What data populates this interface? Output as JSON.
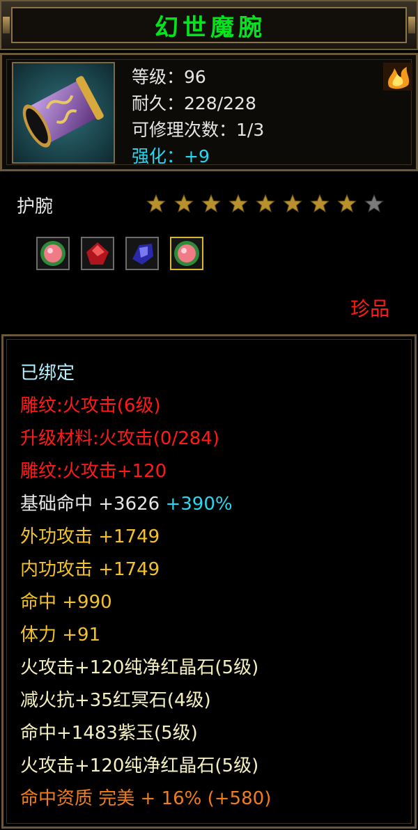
{
  "title": "幻世魔腕",
  "icon": {
    "name": "bracer-icon",
    "fire": "fire-emblem-icon"
  },
  "stats": {
    "level": "等级：96",
    "durability": "耐久：228/228",
    "repairs": "可修理次数：1/3",
    "enhance": "强化：+9"
  },
  "item_type": "护腕",
  "stars": {
    "filled": 8,
    "total": 9
  },
  "gems": [
    "pink-gem-icon",
    "red-gem-icon",
    "blue-gem-icon",
    "pink-gem-icon"
  ],
  "quality": "珍品",
  "attributes": {
    "bound": "已绑定",
    "carve1": "雕纹:火攻击(6级)",
    "upgrade": "升级材料:火攻击(0/284)",
    "carve2": "雕纹:火攻击+120",
    "base_hit": "基础命中  +3626",
    "base_hit_pct": "+390%",
    "outer_atk": "外功攻击  +1749",
    "inner_atk": "内功攻击  +1749",
    "hit": "命中  +990",
    "stamina": "体力  +91",
    "gem1": "火攻击+120纯净红晶石(5级)",
    "gem2": "减火抗+35红冥石(4级)",
    "gem3": "命中+1483紫玉(5级)",
    "gem4": "火攻击+120纯净红晶石(5级)",
    "aptitude": "命中资质  完美  +  16%  (+580)"
  },
  "colors": {
    "title": "#00e61a",
    "red": "#ff1a1a",
    "yellow": "#f3c22b",
    "cyan": "#22d7f0",
    "orange": "#f07d1c",
    "border": "#6a5838"
  }
}
